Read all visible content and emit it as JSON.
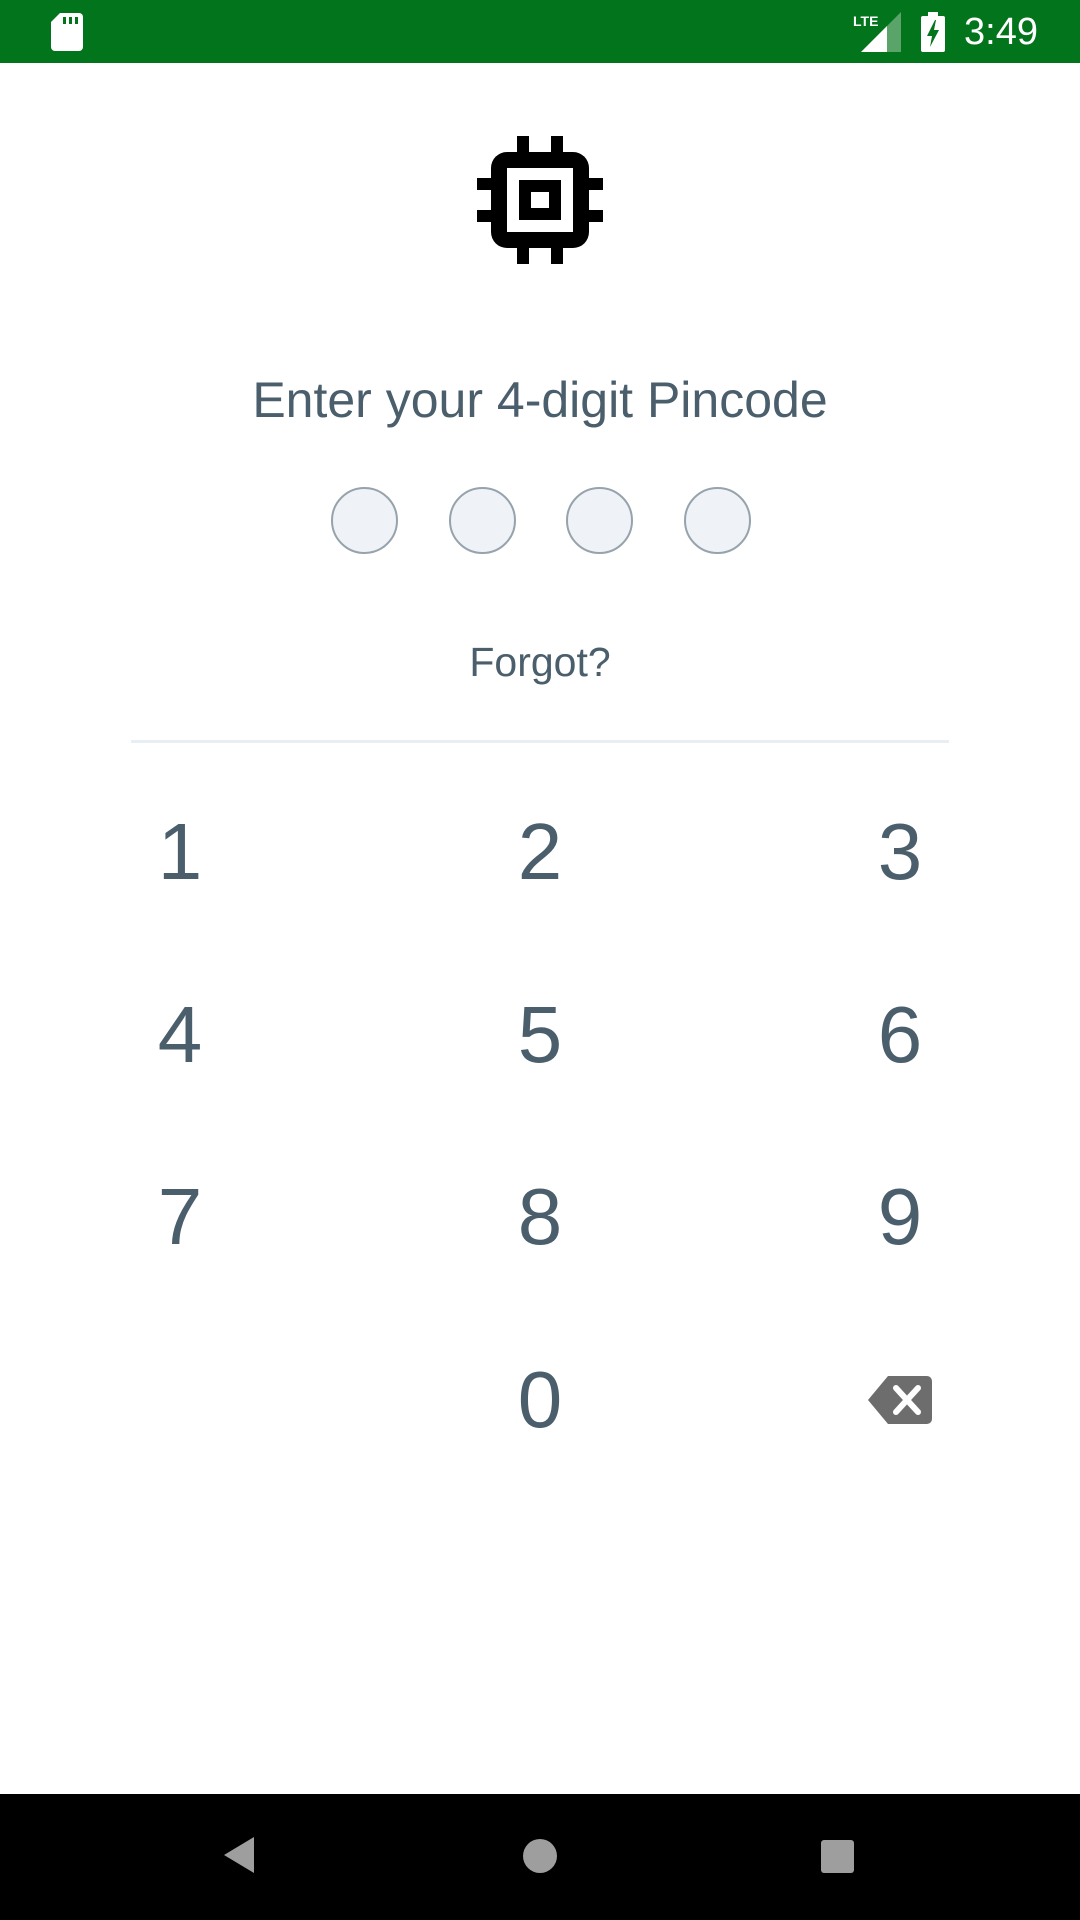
{
  "status_bar": {
    "time": "3:49",
    "network_label": "LTE",
    "icons": [
      "sd-card-icon",
      "lte-signal-icon",
      "battery-charging-icon"
    ],
    "background_color": "#02741b"
  },
  "logo": {
    "icon": "chip-icon"
  },
  "prompt": {
    "text": "Enter your 4-digit Pincode"
  },
  "pin": {
    "length": 4,
    "entered": 0
  },
  "forgot_label": "Forgot?",
  "keypad": {
    "keys": [
      "1",
      "2",
      "3",
      "4",
      "5",
      "6",
      "7",
      "8",
      "9",
      "0"
    ],
    "backspace_icon": "backspace-icon"
  },
  "nav_bar": {
    "icons": [
      "back-icon",
      "home-icon",
      "recents-icon"
    ]
  },
  "colors": {
    "text": "#4a5e6c",
    "dot_fill": "#eff3f8",
    "dot_border": "#96a3ad",
    "divider": "#e8eff4"
  }
}
